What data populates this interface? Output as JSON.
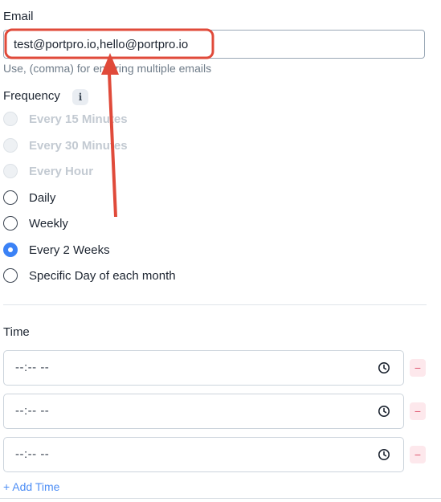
{
  "email": {
    "label": "Email",
    "value": "test@portpro.io,hello@portpro.io",
    "hint": "Use, (comma) for entering multiple emails"
  },
  "frequency": {
    "label": "Frequency",
    "info_icon": "info-icon",
    "options": [
      {
        "label": "Every 15 Minutes",
        "disabled": true,
        "checked": false
      },
      {
        "label": "Every 30 Minutes",
        "disabled": true,
        "checked": false
      },
      {
        "label": "Every Hour",
        "disabled": true,
        "checked": false
      },
      {
        "label": "Daily",
        "disabled": false,
        "checked": false
      },
      {
        "label": "Weekly",
        "disabled": false,
        "checked": false
      },
      {
        "label": "Every 2 Weeks",
        "disabled": false,
        "checked": true
      },
      {
        "label": "Specific Day of each month",
        "disabled": false,
        "checked": false
      }
    ]
  },
  "time": {
    "label": "Time",
    "slots": [
      {
        "value": "--:-- --",
        "remove": "−"
      },
      {
        "value": "--:-- --",
        "remove": "−"
      },
      {
        "value": "--:-- --",
        "remove": "−"
      }
    ],
    "add_label": "+ Add Time"
  },
  "colors": {
    "accent": "#3b82f6",
    "annotation": "#e04a3a",
    "remove": "#e05b73"
  }
}
